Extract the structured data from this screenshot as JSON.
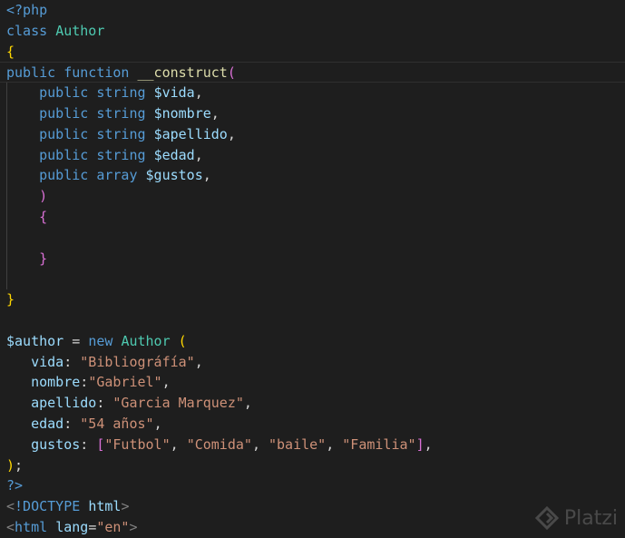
{
  "code": {
    "l1": {
      "a": "<?php"
    },
    "l2": {
      "kw": "class",
      "name": "Author"
    },
    "l3": {
      "brace": "{"
    },
    "l4": {
      "kw1": "public",
      "kw2": "function",
      "fn": "__construct",
      "paren": "("
    },
    "params": [
      {
        "kw": "public",
        "type": "string",
        "name": "$vida",
        "sep": ","
      },
      {
        "kw": "public",
        "type": "string",
        "name": "$nombre",
        "sep": ","
      },
      {
        "kw": "public",
        "type": "string",
        "name": "$apellido",
        "sep": ","
      },
      {
        "kw": "public",
        "type": "string",
        "name": "$edad",
        "sep": ","
      },
      {
        "kw": "public",
        "type": "array",
        "name": "$gustos",
        "sep": ","
      }
    ],
    "l10": {
      "paren": ")"
    },
    "l11": {
      "brace": "{"
    },
    "l13": {
      "brace": "}"
    },
    "l15": {
      "brace": "}"
    },
    "l17": {
      "var": "$author",
      "eq": " = ",
      "kw": "new",
      "cls": "Author",
      "paren": "("
    },
    "l18": {
      "key": "vida",
      "colon": ": ",
      "val": "\"Bibliográfía\"",
      "sep": ","
    },
    "l19": {
      "key": "nombre",
      "colon": ":",
      "val": "\"Gabriel\"",
      "sep": ","
    },
    "l20": {
      "key": "apellido",
      "colon": ": ",
      "val": "\"Garcia Marquez\"",
      "sep": ","
    },
    "l21": {
      "key": "edad",
      "colon": ": ",
      "val": "\"54 años\"",
      "sep": ","
    },
    "l22": {
      "key": "gustos",
      "colon": ": ",
      "open": "[",
      "v1": "\"Futbol\"",
      "c": ", ",
      "v2": "\"Comida\"",
      "v3": "\"baile\"",
      "v4": "\"Familia\"",
      "close": "]",
      "sep": ","
    },
    "l23": {
      "paren": ")",
      "semi": ";"
    },
    "l24": {
      "a": "?>"
    },
    "l25": {
      "lt": "<",
      "doctype": "!DOCTYPE",
      "sp": " ",
      "html": "html",
      "gt": ">"
    },
    "l26": {
      "lt": "<",
      "tag": "html",
      "sp": " ",
      "attr": "lang",
      "eq": "=",
      "val": "\"en\"",
      "gt": ">"
    }
  },
  "watermark": {
    "text": "Platzi",
    "icon": "platzi-logo-icon"
  },
  "colors": {
    "background": "#1e1e1e",
    "keyword": "#569cd6",
    "class": "#4ec9b0",
    "string": "#ce9178",
    "variable": "#9cdcfe"
  }
}
